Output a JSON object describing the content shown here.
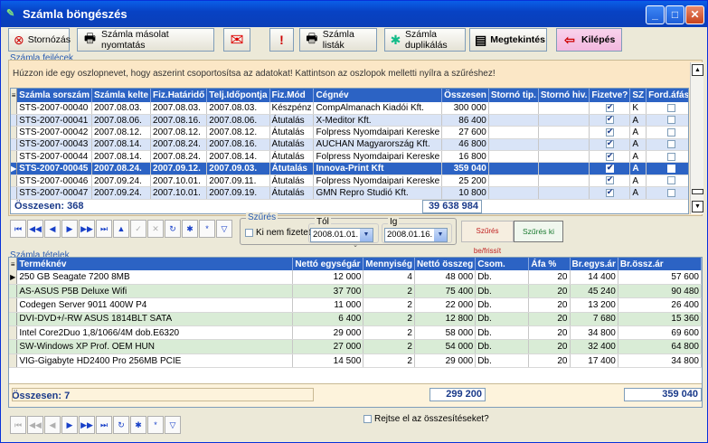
{
  "window": {
    "title": "Számla böngészés",
    "min": "_",
    "max": "□",
    "close": "✕"
  },
  "toolbar": {
    "storno": "Stornózás",
    "print_copy": "Számla másolat nyomtatás",
    "lists": "Számla listák",
    "duplicates": "Számla duplikálás",
    "view": "Megtekintés",
    "exit": "Kilépés"
  },
  "headers_section": {
    "label": "Számla fejlécek",
    "hint": "Húzzon ide egy oszlopnevet, hogy aszerint csoportosítsa az adatokat! Kattintson az oszlopok melletti nyílra a szűréshez!"
  },
  "invoices": {
    "columns": [
      "Számla sorszám",
      "Számla kelte",
      "Fiz.Határidő",
      "Telj.Időpontja",
      "Fiz.Mód",
      "Cégnév",
      "Összesen",
      "Stornó tip.",
      "Stornó hiv.",
      "Fizetve?",
      "SZ",
      "Ford.áfás?"
    ],
    "rows": [
      [
        "STS-2007-00040",
        "2007.08.03.",
        "2007.08.03.",
        "2007.08.03.",
        "Készpénz",
        "CompAlmanach Kiadói Kft.",
        "300 000",
        "",
        "",
        true,
        "K",
        false
      ],
      [
        "STS-2007-00041",
        "2007.08.06.",
        "2007.08.16.",
        "2007.08.06.",
        "Átutalás",
        "X-Meditor Kft.",
        "86 400",
        "",
        "",
        true,
        "A",
        false
      ],
      [
        "STS-2007-00042",
        "2007.08.12.",
        "2007.08.12.",
        "2007.08.12.",
        "Átutalás",
        "Folpress Nyomdaipari Kereske",
        "27 600",
        "",
        "",
        true,
        "A",
        false
      ],
      [
        "STS-2007-00043",
        "2007.08.14.",
        "2007.08.24.",
        "2007.08.16.",
        "Átutalás",
        "AUCHAN Magyarország Kft.",
        "46 800",
        "",
        "",
        true,
        "A",
        false
      ],
      [
        "STS-2007-00044",
        "2007.08.14.",
        "2007.08.24.",
        "2007.08.14.",
        "Átutalás",
        "Folpress Nyomdaipari Kereske",
        "16 800",
        "",
        "",
        true,
        "A",
        false
      ],
      [
        "STS-2007-00045",
        "2007.08.24.",
        "2007.09.12.",
        "2007.09.03.",
        "Átutalás",
        "Innova-Print Kft",
        "359 040",
        "",
        "",
        true,
        "A",
        false
      ],
      [
        "STS-2007-00046",
        "2007.09.24.",
        "2007.10.01.",
        "2007.09.11.",
        "Átutalás",
        "Folpress Nyomdaipari Kereske",
        "25 200",
        "",
        "",
        true,
        "A",
        false
      ],
      [
        "STS-2007-00047",
        "2007.09.24.",
        "2007.10.01.",
        "2007.09.19.",
        "Átutalás",
        "GMN Repro Studió Kft.",
        "10 800",
        "",
        "",
        true,
        "A",
        false
      ]
    ],
    "selected_row": 5,
    "count_label": "Összesen: 368",
    "total": "39 638 984"
  },
  "filter": {
    "legend": "Szűrés",
    "unpaid_label": "Ki nem fizetett",
    "from_label": "Tól",
    "from_value": "2008.01.01.",
    "to_label": "Ig",
    "to_value": "2008.01.16.",
    "refresh": "Szűrés be/frissít",
    "off": "Szűrés ki"
  },
  "items_section": {
    "label": "Számla tételek"
  },
  "items": {
    "columns": [
      "Terméknév",
      "Nettó egységár",
      "Mennyiség",
      "Nettó összeg",
      "Csom.",
      "Áfa %",
      "Br.egys.ár",
      "Br.össz.ár"
    ],
    "rows": [
      [
        "250 GB Seagate 7200 8MB",
        "12 000",
        "4",
        "48 000",
        "Db.",
        "20",
        "14 400",
        "57 600"
      ],
      [
        "AS-ASUS P5B Deluxe Wifi",
        "37 700",
        "2",
        "75 400",
        "Db.",
        "20",
        "45 240",
        "90 480"
      ],
      [
        "Codegen Server 9011 400W P4",
        "11 000",
        "2",
        "22 000",
        "Db.",
        "20",
        "13 200",
        "26 400"
      ],
      [
        "DVI-DVD+/-RW ASUS 1814BLT SATA",
        "6 400",
        "2",
        "12 800",
        "Db.",
        "20",
        "7 680",
        "15 360"
      ],
      [
        "Intel Core2Duo 1,8/1066/4M dob.E6320",
        "29 000",
        "2",
        "58 000",
        "Db.",
        "20",
        "34 800",
        "69 600"
      ],
      [
        "SW-Windows XP Prof. OEM HUN",
        "27 000",
        "2",
        "54 000",
        "Db.",
        "20",
        "32 400",
        "64 800"
      ],
      [
        "VIG-Gigabyte HD2400 Pro 256MB PCIE",
        "14 500",
        "2",
        "29 000",
        "Db.",
        "20",
        "17 400",
        "34 800"
      ]
    ],
    "count_label": "Összesen: 7",
    "net_total": "299 200",
    "gross_total": "359 040",
    "hide_totals_label": "Rejtse el az összesítéseket?"
  }
}
